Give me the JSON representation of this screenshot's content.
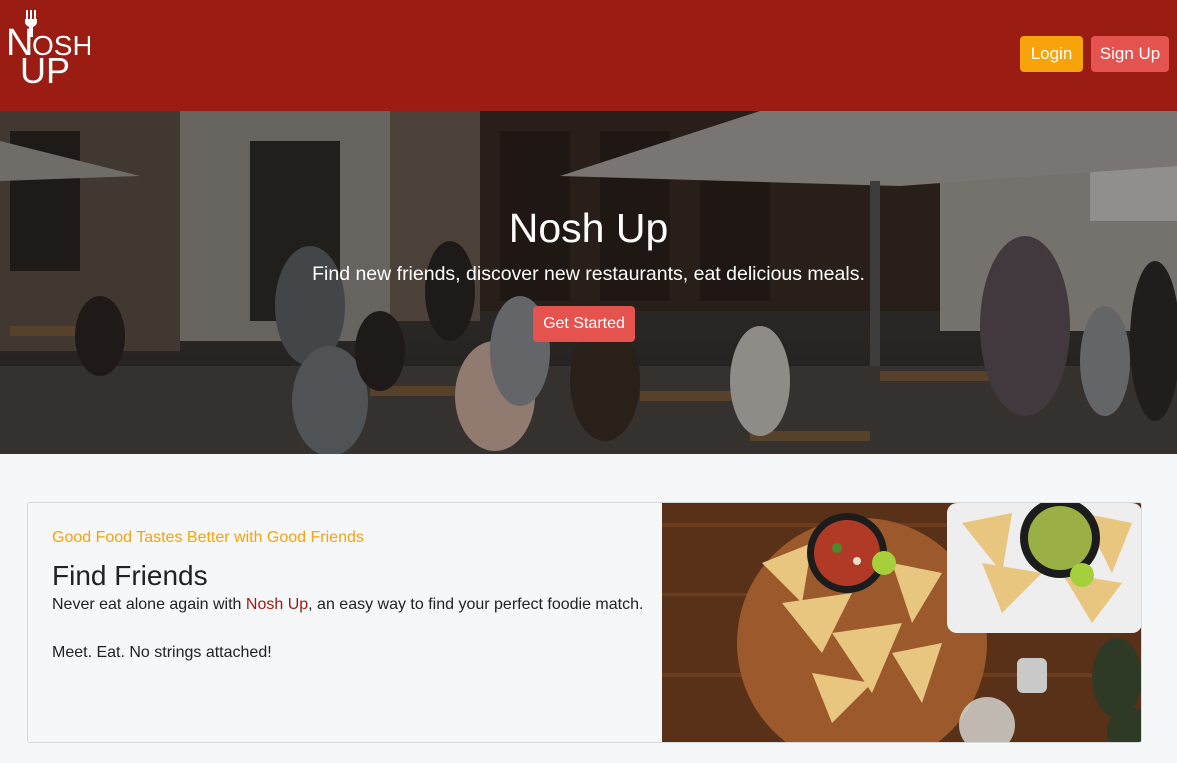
{
  "brand": {
    "logo_text": "NOSH UP",
    "colors": {
      "primary": "#9a1c12",
      "accent": "#f7a30c",
      "cta": "#e5534f"
    }
  },
  "nav": {
    "login_label": "Login",
    "signup_label": "Sign Up"
  },
  "hero": {
    "title": "Nosh Up",
    "subtitle": "Find new friends, discover new restaurants, eat delicious meals.",
    "cta_label": "Get Started"
  },
  "feature": {
    "kicker": "Good Food Tastes Better with Good Friends",
    "title": "Find Friends",
    "text_before": "Never eat alone again with ",
    "text_brand": "Nosh Up",
    "text_after": ", an easy way to find your perfect foodie match.",
    "tagline": "Meet. Eat. No strings attached!"
  },
  "icons": [
    "fork-icon"
  ]
}
